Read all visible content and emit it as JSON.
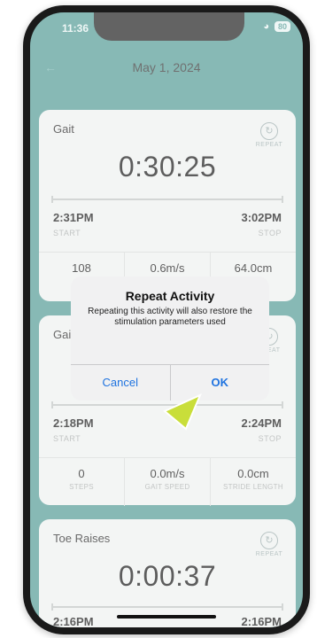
{
  "status_bar": {
    "time": "11:36",
    "battery": "80"
  },
  "nav": {
    "title": "May 1, 2024"
  },
  "cards": [
    {
      "title": "Gait",
      "repeat_label": "REPEAT",
      "duration": "0:30:25",
      "start_time": "2:31PM",
      "start_label": "START",
      "stop_time": "3:02PM",
      "stop_label": "STOP",
      "stats": [
        {
          "value": "108",
          "label": "S"
        },
        {
          "value": "0.6m/s",
          "label": ""
        },
        {
          "value": "64.0cm",
          "label": "NGTH"
        }
      ]
    },
    {
      "title": "Gai",
      "repeat_label": "EPEAT",
      "start_time": "2:18PM",
      "start_label": "START",
      "stop_time": "2:24PM",
      "stop_label": "STOP",
      "stats": [
        {
          "value": "0",
          "label": "STEPS"
        },
        {
          "value": "0.0m/s",
          "label": "GAIT SPEED"
        },
        {
          "value": "0.0cm",
          "label": "STRIDE LENGTH"
        }
      ]
    },
    {
      "title": "Toe Raises",
      "repeat_label": "REPEAT",
      "duration": "0:00:37",
      "start_time": "2:16PM",
      "stop_time": "2:16PM"
    }
  ],
  "alert": {
    "title": "Repeat Activity",
    "message": "Repeating this activity will also restore the stimulation parameters used",
    "cancel_label": "Cancel",
    "ok_label": "OK"
  },
  "colors": {
    "background": "#4e9892",
    "accent": "#1f73e0",
    "pointer": "#c9de3a"
  }
}
